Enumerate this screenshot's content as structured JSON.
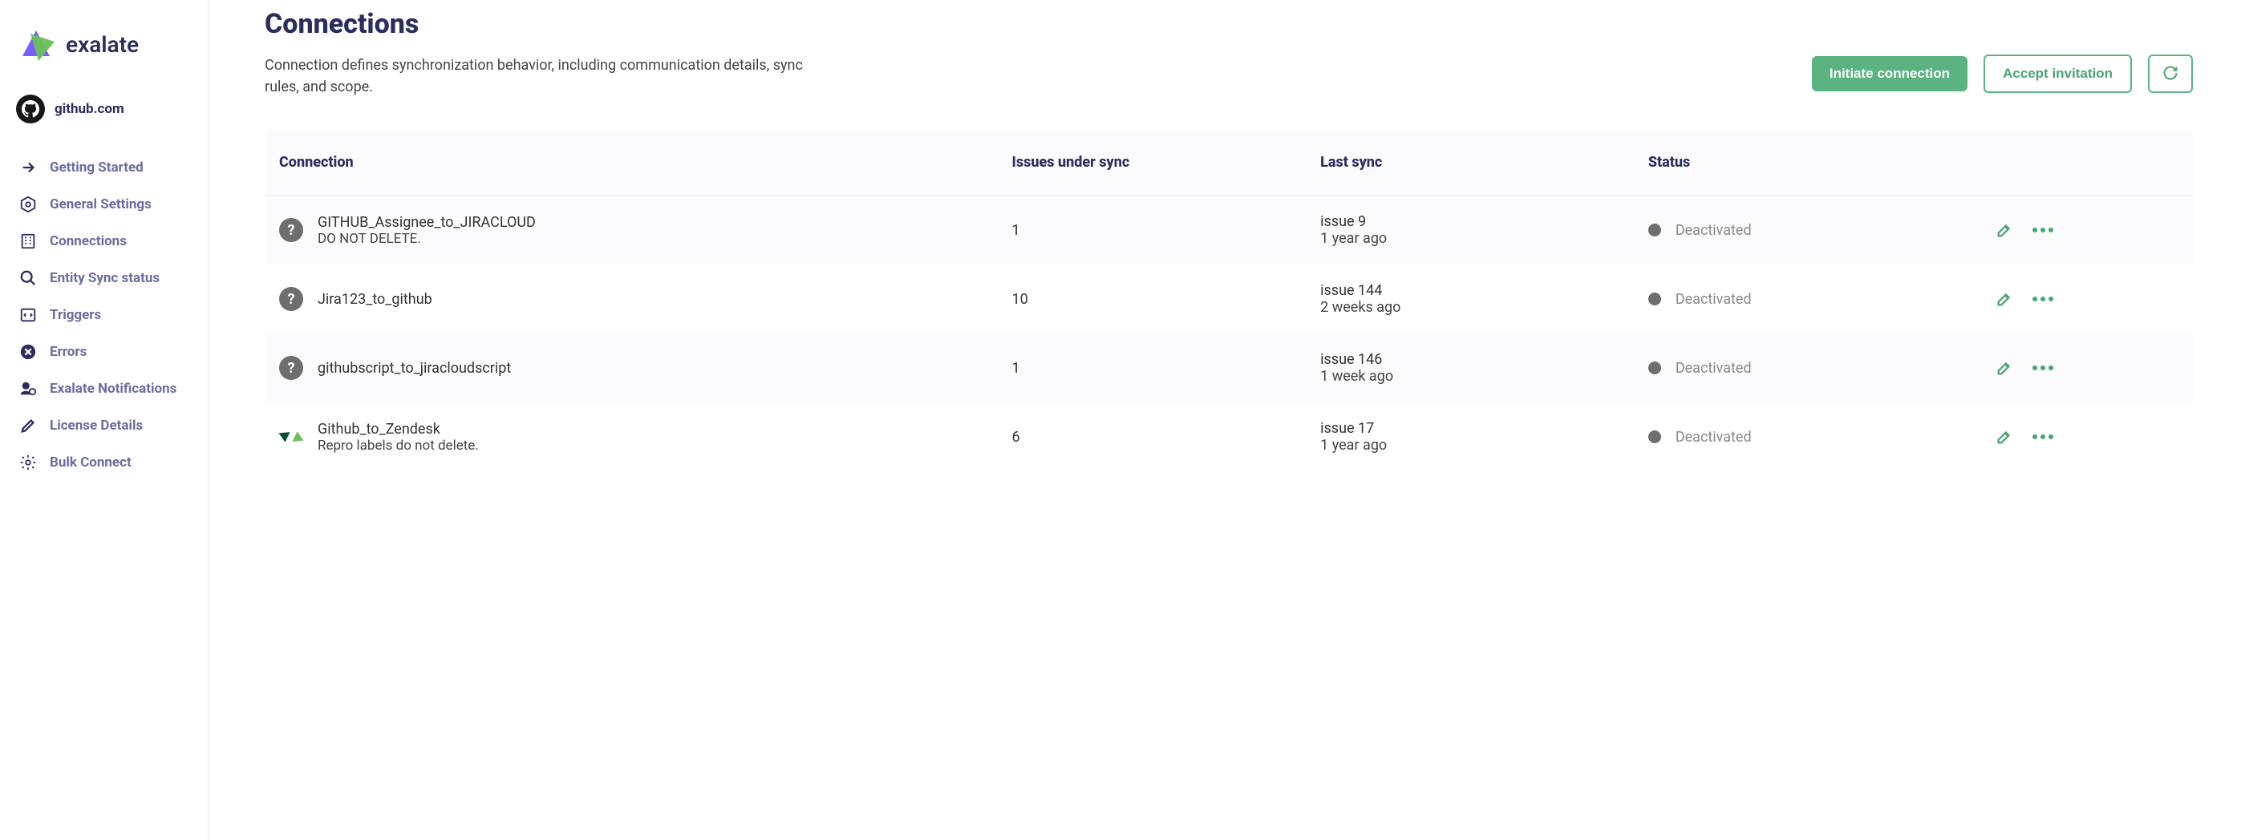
{
  "brand": {
    "name": "exalate"
  },
  "instance": {
    "label": "github.com"
  },
  "sidebar": {
    "items": [
      {
        "id": "getting-started",
        "label": "Getting Started",
        "icon": "arrow"
      },
      {
        "id": "general-settings",
        "label": "General Settings",
        "icon": "gear-hex"
      },
      {
        "id": "connections",
        "label": "Connections",
        "icon": "building"
      },
      {
        "id": "entity-sync-status",
        "label": "Entity Sync status",
        "icon": "search"
      },
      {
        "id": "triggers",
        "label": "Triggers",
        "icon": "code-box"
      },
      {
        "id": "errors",
        "label": "Errors",
        "icon": "x-circle"
      },
      {
        "id": "exalate-notifications",
        "label": "Exalate Notifications",
        "icon": "bell-user"
      },
      {
        "id": "license-details",
        "label": "License Details",
        "icon": "pencil"
      },
      {
        "id": "bulk-connect",
        "label": "Bulk Connect",
        "icon": "cog"
      }
    ]
  },
  "page": {
    "title": "Connections",
    "description": "Connection defines synchronization behavior, including communication details, sync rules, and scope.",
    "actions": {
      "initiate": "Initiate connection",
      "accept": "Accept invitation"
    }
  },
  "table": {
    "headers": {
      "connection": "Connection",
      "issues": "Issues under sync",
      "lastSync": "Last sync",
      "status": "Status"
    },
    "rows": [
      {
        "icon": "question",
        "title": "GITHUB_Assignee_to_JIRACLOUD",
        "subtitle": "DO NOT DELETE.",
        "issues": "1",
        "lastSyncLine1": "issue 9",
        "lastSyncLine2": "1 year ago",
        "status": "Deactivated"
      },
      {
        "icon": "question",
        "title": "Jira123_to_github",
        "subtitle": "",
        "issues": "10",
        "lastSyncLine1": "issue 144",
        "lastSyncLine2": "2 weeks ago",
        "status": "Deactivated"
      },
      {
        "icon": "question",
        "title": "githubscript_to_jiracloudscript",
        "subtitle": "",
        "issues": "1",
        "lastSyncLine1": "issue 146",
        "lastSyncLine2": "1 week ago",
        "status": "Deactivated"
      },
      {
        "icon": "zendesk",
        "title": "Github_to_Zendesk",
        "subtitle": "Repro labels do not delete.",
        "issues": "6",
        "lastSyncLine1": "issue 17",
        "lastSyncLine2": "1 year ago",
        "status": "Deactivated"
      }
    ]
  }
}
